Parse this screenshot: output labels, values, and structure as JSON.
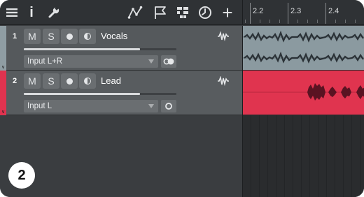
{
  "toolbar": {
    "icons": [
      "menu-icon",
      "info-icon",
      "wrench-icon",
      "automation-curve-icon",
      "flag-icon",
      "grid-quantize-icon",
      "metronome-icon",
      "add-icon"
    ],
    "info_label": "i",
    "add_label": "+"
  },
  "ruler": {
    "marks": [
      "2.2",
      "2.3",
      "2.4"
    ]
  },
  "tracks": [
    {
      "number": "1",
      "name": "Vocals",
      "mute": "M",
      "solo": "S",
      "input": "Input L+R",
      "volume_fraction": 0.76,
      "color": "#8f9da3",
      "monitor_icon": "stereo-link-icon"
    },
    {
      "number": "2",
      "name": "Lead",
      "mute": "M",
      "solo": "S",
      "input": "Input L",
      "volume_fraction": 0.76,
      "color": "#e0334f",
      "monitor_icon": "mono-circle-icon"
    }
  ],
  "badge": {
    "label": "2"
  }
}
